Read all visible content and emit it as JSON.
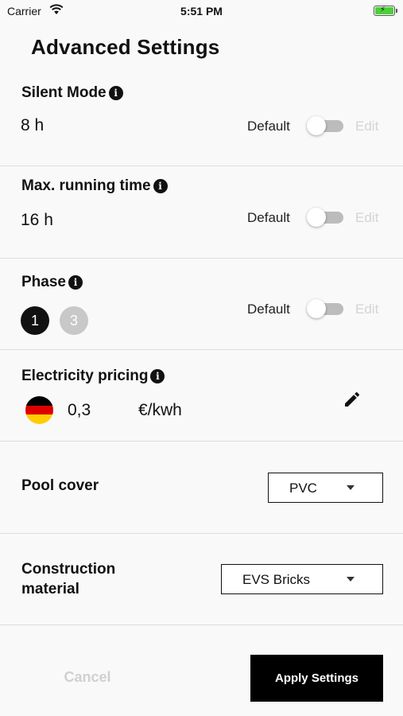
{
  "status_bar": {
    "carrier": "Carrier",
    "time": "5:51 PM"
  },
  "page": {
    "title": "Advanced Settings"
  },
  "silent_mode": {
    "label": "Silent Mode",
    "value": "8  h",
    "default_label": "Default",
    "edit_label": "Edit",
    "default_on": false
  },
  "max_running_time": {
    "label": "Max. running time",
    "value": "16  h",
    "default_label": "Default",
    "edit_label": "Edit",
    "default_on": false
  },
  "phase": {
    "label": "Phase",
    "options": [
      "1",
      "3"
    ],
    "selected": "1",
    "default_label": "Default",
    "edit_label": "Edit",
    "default_on": false
  },
  "electricity_pricing": {
    "label": "Electricity pricing",
    "value": "0,3",
    "unit": "€/kwh",
    "flag_colors": [
      "#000000",
      "#dd0000",
      "#ffce00"
    ]
  },
  "pool_cover": {
    "label": "Pool cover",
    "selected": "PVC"
  },
  "construction_material": {
    "label": "Construction\nmaterial",
    "selected": "EVS Bricks"
  },
  "footer": {
    "cancel_label": "Cancel",
    "apply_label": "Apply Settings"
  },
  "colors": {
    "accent": "#000000",
    "toggle_track": "#bcbcbc",
    "disabled_text": "#d0d0d0"
  }
}
